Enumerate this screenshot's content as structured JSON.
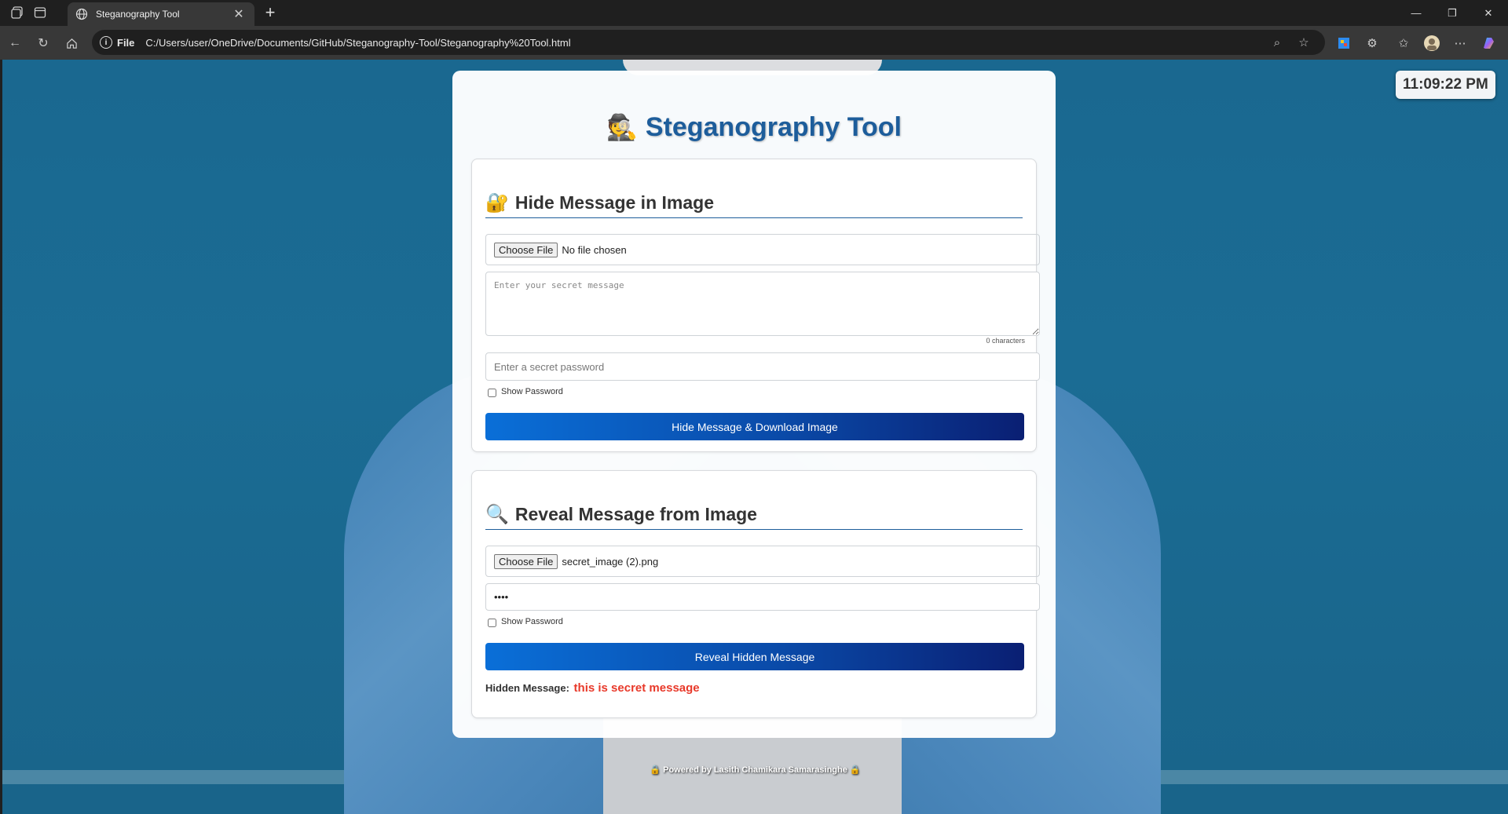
{
  "browser": {
    "tab_title": "Steganography Tool",
    "address_scheme": "File",
    "address_url": "C:/Users/user/OneDrive/Documents/GitHub/Steganography-Tool/Steganography%20Tool.html"
  },
  "clock": {
    "time": "11:09:22 PM"
  },
  "app": {
    "title_emoji": "🕵️",
    "title": "Steganography Tool"
  },
  "hide": {
    "emoji": "🔐",
    "title": "Hide Message in Image",
    "file_button": "Choose File",
    "file_status": "No file chosen",
    "message_placeholder": "Enter your secret message",
    "char_count": "0 characters",
    "password_placeholder": "Enter a secret password",
    "show_password": "Show Password",
    "button": "Hide Message & Download Image"
  },
  "reveal": {
    "emoji": "🔍",
    "title": "Reveal Message from Image",
    "file_button": "Choose File",
    "file_status": "secret_image (2).png",
    "password_value": "••••",
    "show_password": "Show Password",
    "button": "Reveal Hidden Message",
    "result_label": "Hidden Message:",
    "result_value": "this is secret message"
  },
  "footer": {
    "text": "🔒 Powered by Lasith Chamikara Samarasinghe 🔒"
  },
  "colors": {
    "accent": "#1d5d9b",
    "button_start": "#0a6fd8",
    "button_end": "#0a1f73",
    "result": "#e8392a"
  }
}
